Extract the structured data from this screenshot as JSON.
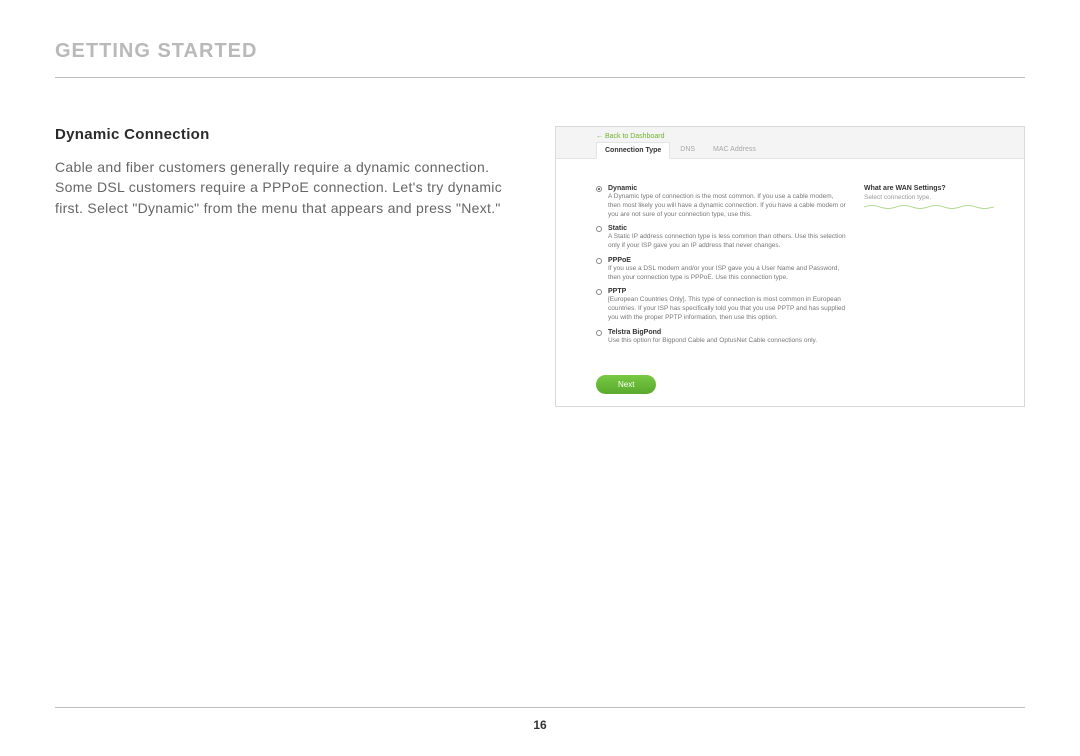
{
  "heading": "GETTING STARTED",
  "subheading": "Dynamic Connection",
  "body": "Cable and fiber customers generally require a dynamic connection. Some DSL customers require a PPPoE connection. Let's try dynamic first. Select \"Dynamic\" from the menu that appears and press \"Next.\"",
  "page_number": "16",
  "screenshot": {
    "back_link": "← Back to Dashboard",
    "tabs": [
      {
        "label": "Connection Type",
        "active": true
      },
      {
        "label": "DNS",
        "active": false
      },
      {
        "label": "MAC Address",
        "active": false
      }
    ],
    "options": [
      {
        "id": "dynamic",
        "title": "Dynamic",
        "desc": "A Dynamic type of connection is the most common. If you use a cable modem, then most likely you will have a dynamic connection. If you have a cable modem or you are not sure of your connection type, use this.",
        "selected": true
      },
      {
        "id": "static",
        "title": "Static",
        "desc": "A Static IP address connection type is less common than others. Use this selection only if your ISP gave you an IP address that never changes.",
        "selected": false
      },
      {
        "id": "pppoe",
        "title": "PPPoE",
        "desc": "If you use a DSL modem and/or your ISP gave you a User Name and Password, then your connection type is PPPoE. Use this connection type.",
        "selected": false
      },
      {
        "id": "pptp",
        "title": "PPTP",
        "desc": "[European Countries Only]. This type of connection is most common in European countries. If your ISP has specifically told you that you use PPTP and has supplied you with the proper PPTP information, then use this option.",
        "selected": false
      },
      {
        "id": "telstra",
        "title": "Telstra BigPond",
        "desc": "Use this option for Bigpond Cable and OptusNet Cable connections only.",
        "selected": false
      }
    ],
    "help": {
      "title": "What are WAN Settings?",
      "sub": "Select connection type."
    },
    "next_label": "Next"
  }
}
